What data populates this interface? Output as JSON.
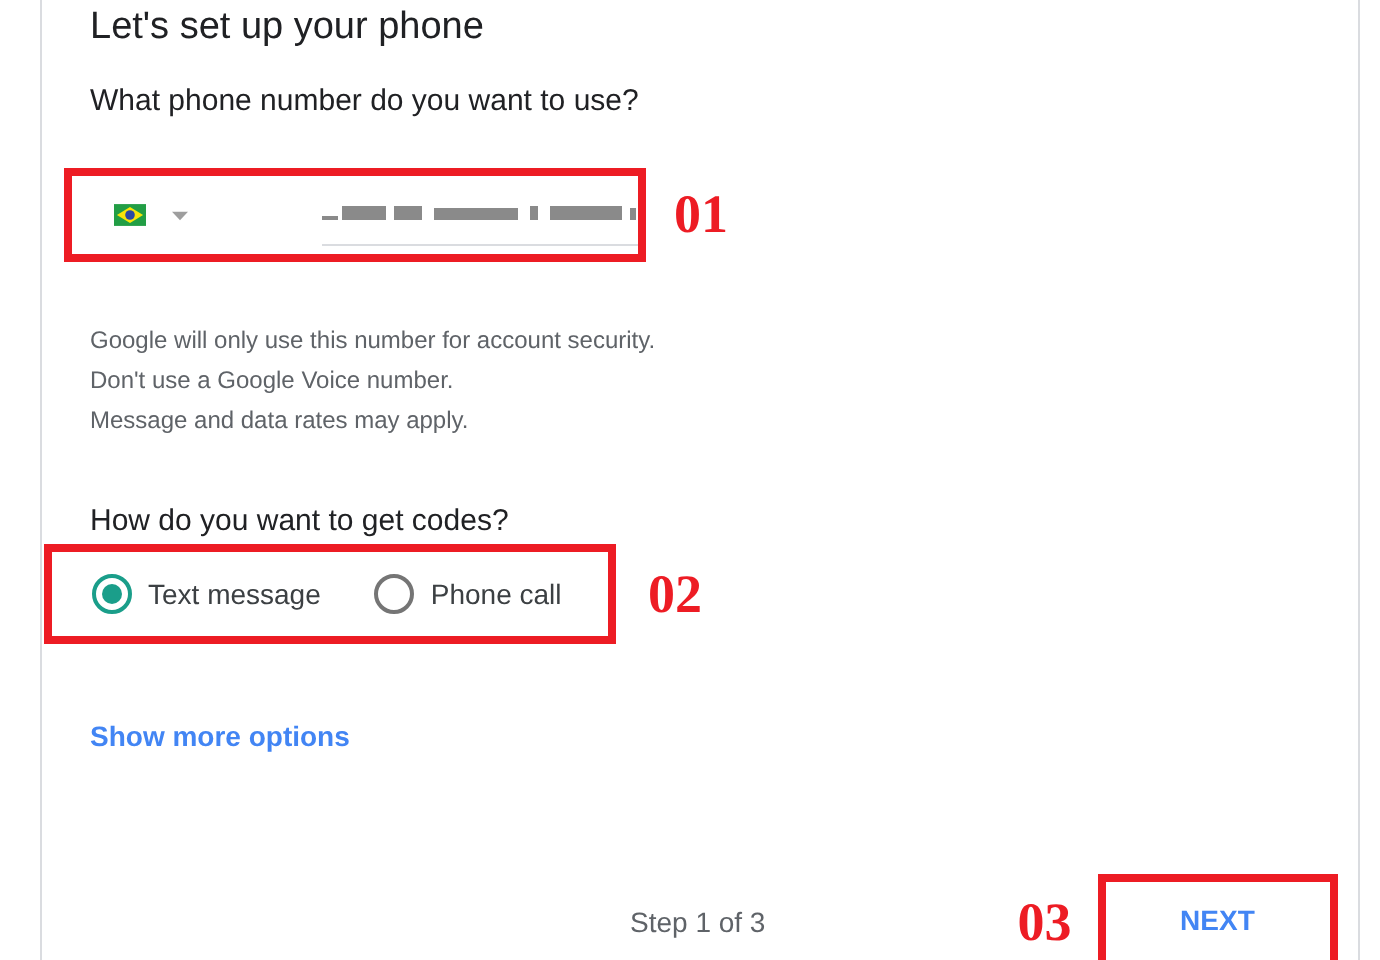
{
  "title": "Let's set up your phone",
  "phone": {
    "question": "What phone number do you want to use?",
    "annotation": "01"
  },
  "notes": [
    "Google will only use this number for account security.",
    "Don't use a Google Voice number.",
    "Message and data rates may apply."
  ],
  "codes": {
    "question": "How do you want to get codes?",
    "annotation": "02",
    "options": [
      {
        "label": "Text message",
        "selected": true
      },
      {
        "label": "Phone call",
        "selected": false
      }
    ]
  },
  "more_link": "Show more options",
  "footer": {
    "step": "Step 1 of 3",
    "annotation": "03",
    "next": "NEXT"
  }
}
